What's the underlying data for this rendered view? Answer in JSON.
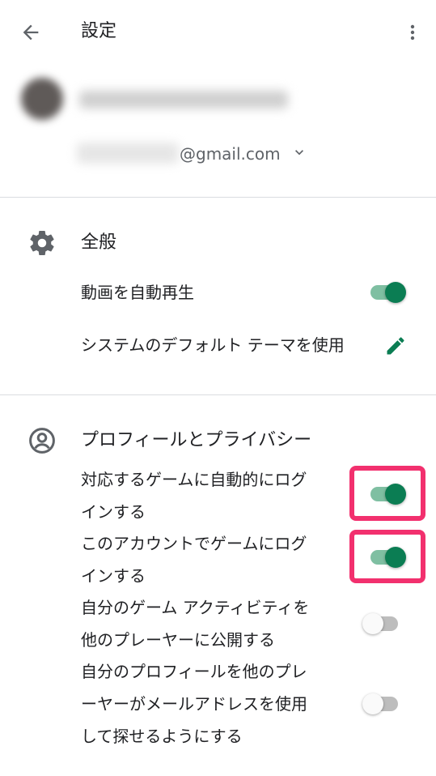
{
  "appbar": {
    "title": "設定",
    "back_icon": "arrow-left-icon",
    "menu_icon": "more-vert-icon"
  },
  "account": {
    "email_suffix": "@gmail.com"
  },
  "general": {
    "title": "全般",
    "icon": "gear-icon",
    "items": [
      {
        "label": "動画を自動再生",
        "control": "toggle",
        "state": "on"
      },
      {
        "label": "システムのデフォルト テーマを使用",
        "control": "edit",
        "icon": "pencil-icon"
      }
    ]
  },
  "privacy": {
    "title": "プロフィールとプライバシー",
    "icon": "account-circle-icon",
    "items": [
      {
        "lines": [
          "対応するゲームに自動的にログ",
          "インする"
        ],
        "state": "on",
        "highlighted": true
      },
      {
        "lines": [
          "このアカウントでゲームにログ",
          "インする"
        ],
        "state": "on",
        "highlighted": true
      },
      {
        "lines": [
          "自分のゲーム アクティビティを",
          "他のプレーヤーに公開する"
        ],
        "state": "off",
        "highlighted": false
      },
      {
        "lines": [
          "自分のプロフィールを他のプレ",
          "ーヤーがメールアドレスを使用",
          "して探せるようにする"
        ],
        "state": "off",
        "highlighted": false
      }
    ]
  },
  "colors": {
    "accent": "#0b7d53",
    "accent_track": "#7fbfa2",
    "highlight": "#f2306e",
    "divider": "#dadce0"
  }
}
